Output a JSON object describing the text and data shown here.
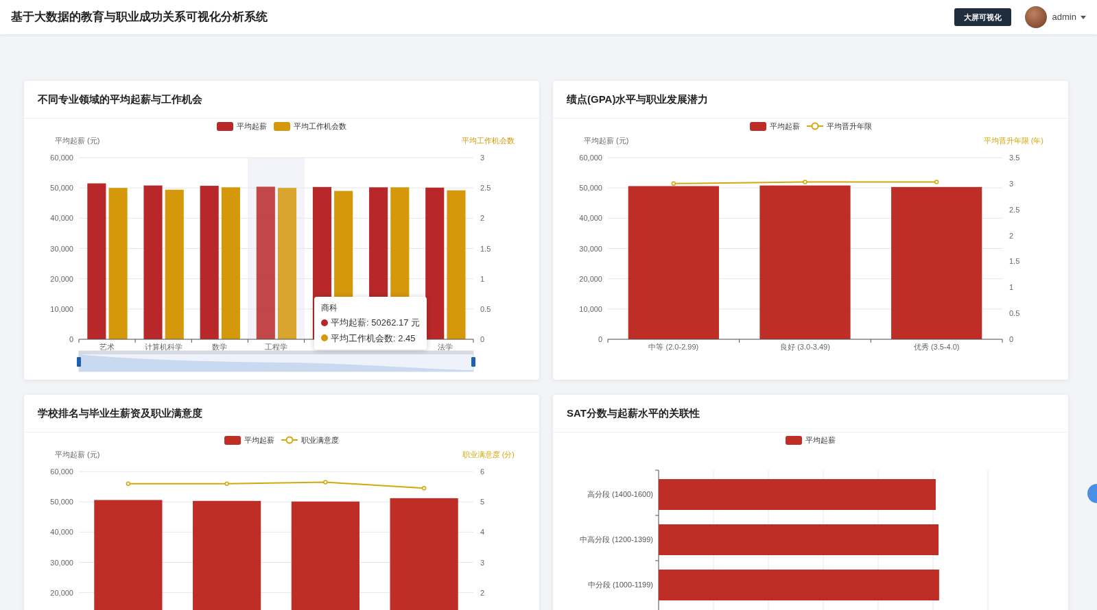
{
  "header": {
    "title": "基于大数据的教育与职业成功关系可视化分析系统",
    "screen_button": "大屏可视化",
    "user": "admin"
  },
  "panels": [
    {
      "kind": "dual",
      "title": "不同专业领域的平均起薪与工作机会",
      "range_slider": true,
      "hovered": [
        false,
        false,
        false,
        true,
        false,
        false,
        false
      ],
      "chart_data": {
        "type": "bar",
        "grid": true,
        "ylabel": "平均起薪 (元)",
        "y2label": "平均工作机会数",
        "categories": [
          "艺术",
          "计算机科学",
          "数学",
          "工程学",
          null,
          null,
          "法学"
        ],
        "ylim": [
          0,
          60000
        ],
        "y2lim": [
          0,
          3
        ],
        "yticks": [
          {
            "value": 0,
            "label": "0"
          },
          {
            "value": 10000,
            "label": "10,000"
          },
          {
            "value": 20000,
            "label": "20,000"
          },
          {
            "value": 30000,
            "label": "30,000"
          },
          {
            "value": 40000,
            "label": "40,000"
          },
          {
            "value": 50000,
            "label": "50,000"
          },
          {
            "value": 60000,
            "label": "60,000"
          }
        ],
        "y2ticks": [
          0,
          0.5,
          1,
          1.5,
          2,
          2.5,
          3
        ],
        "series": [
          {
            "name": "平均起薪",
            "color": "#b8282a",
            "values": [
              51500,
              50800,
              50700,
              50400,
              50300,
              50200,
              50100
            ]
          },
          {
            "name": "平均工作机会数",
            "axis": "y2",
            "color": "#d4980a",
            "values": [
              2.5,
              2.47,
              2.51,
              2.5,
              2.45,
              2.51,
              2.46
            ]
          }
        ]
      },
      "tooltip": {
        "title": "商科",
        "rows": [
          {
            "text": "平均起薪: 50262.17 元",
            "color": "#b8282a"
          },
          {
            "text": "平均工作机会数: 2.45",
            "color": "#d4980a"
          }
        ]
      }
    },
    {
      "kind": "dual",
      "title": "绩点(GPA)水平与职业发展潜力",
      "chart_data": {
        "type": "bar",
        "grid": true,
        "ylabel": "平均起薪 (元)",
        "y2label": "平均晋升年限 (年)",
        "categories": [
          "中等 (2.0-2.99)",
          "良好 (3.0-3.49)",
          "优秀 (3.5-4.0)"
        ],
        "ylim": [
          0,
          60000
        ],
        "y2lim": [
          0,
          3.5
        ],
        "yticks": [
          {
            "value": 0,
            "label": "0"
          },
          {
            "value": 10000,
            "label": "10,000"
          },
          {
            "value": 20000,
            "label": "20,000"
          },
          {
            "value": 30000,
            "label": "30,000"
          },
          {
            "value": 40000,
            "label": "40,000"
          },
          {
            "value": 50000,
            "label": "50,000"
          },
          {
            "value": 60000,
            "label": "60,000"
          }
        ],
        "y2ticks": [
          0,
          0.5,
          1,
          1.5,
          2,
          2.5,
          3,
          3.5
        ],
        "series": [
          {
            "name": "平均起薪",
            "color": "#be2d26",
            "values": [
              50600,
              50800,
              50300
            ]
          },
          {
            "name": "平均晋升年限",
            "type": "line",
            "marker": "circle",
            "axis": "y2",
            "color": "#d4a80a",
            "values": [
              3.0,
              3.03,
              3.03
            ]
          }
        ]
      }
    },
    {
      "kind": "dual",
      "title": "学校排名与毕业生薪资及职业满意度",
      "chart_data": {
        "type": "bar",
        "grid": true,
        "ylabel": "平均起薪 (元)",
        "y2label": "职业满意度 (分)",
        "ylim": [
          0,
          60000
        ],
        "y2lim": [
          0,
          6
        ],
        "yticks": [
          {
            "value": 20000,
            "label": "20,000"
          },
          {
            "value": 30000,
            "label": "30,000"
          },
          {
            "value": 40000,
            "label": "40,000"
          },
          {
            "value": 50000,
            "label": "50,000"
          },
          {
            "value": 60000,
            "label": "60,000"
          }
        ],
        "y2ticks": [
          2,
          3,
          4,
          5,
          6
        ],
        "series": [
          {
            "name": "平均起薪",
            "color": "#be2d26",
            "values": [
              50600,
              50300,
              50100,
              51200
            ]
          },
          {
            "name": "职业满意度",
            "type": "line",
            "marker": "circle",
            "axis": "y2",
            "color": "#d4a80a",
            "values": [
              5.6,
              5.6,
              5.65,
              5.45
            ]
          }
        ]
      }
    },
    {
      "kind": "hbar",
      "title": "SAT分数与起薪水平的关联性",
      "legend": [
        {
          "name": "平均起薪",
          "color": "#be2d26"
        }
      ],
      "categories": [
        "高分段 (1400-1600)",
        "中高分段 (1200-1399)",
        "中分段 (1000-1199)"
      ]
    }
  ]
}
